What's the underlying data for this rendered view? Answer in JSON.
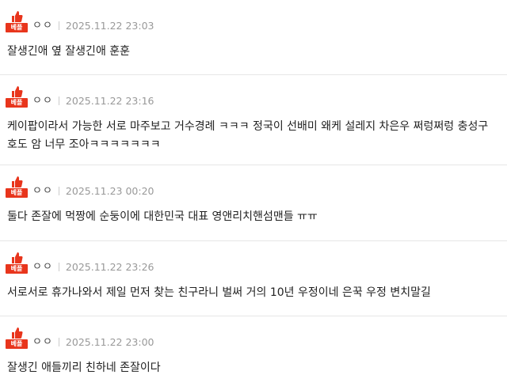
{
  "comments": [
    {
      "badge": "베플",
      "author": "ㅇㅇ",
      "date": "2025.11.22 23:03",
      "text": "잘생긴애 옆 잘생긴애 훈훈"
    },
    {
      "badge": "베플",
      "author": "ㅇㅇ",
      "date": "2025.11.22 23:16",
      "text": "케이팝이라서 가능한 서로 마주보고 거수경례 ㅋㅋㅋ 정국이 선배미 왜케 설레지 차은우 쩌렁쩌렁 충성구호도 암 너무 조아ㅋㅋㅋㅋㅋㅋㅋ"
    },
    {
      "badge": "베플",
      "author": "ㅇㅇ",
      "date": "2025.11.23 00:20",
      "text": "둘다 존잘에 먹짱에 순둥이에 대한민국 대표 영앤리치핸섬맨들 ㅠㅠ"
    },
    {
      "badge": "베플",
      "author": "ㅇㅇ",
      "date": "2025.11.22 23:26",
      "text": "서로서로 휴가나와서 제일 먼저 찾는 친구라니 벌써 거의 10년 우정이네 은꾹 우정 변치말길"
    },
    {
      "badge": "베플",
      "author": "ㅇㅇ",
      "date": "2025.11.22 23:00",
      "text": "잘생긴 애들끼리 친하네 존잘이다"
    }
  ],
  "colors": {
    "badge": "#e8351c",
    "date": "#999999",
    "text": "#222222",
    "divider": "#e6e6e6"
  },
  "icons": {
    "badge": "thumbs-up-icon"
  }
}
